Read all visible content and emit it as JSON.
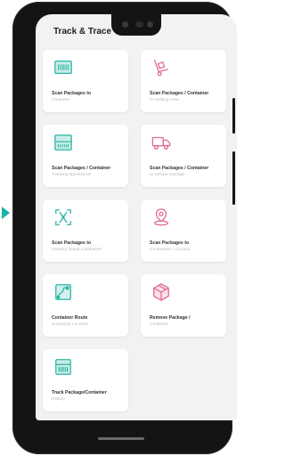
{
  "app": {
    "title": "Track & Trace"
  },
  "tiles": [
    {
      "label": "Scan Packages to",
      "sub": "Container",
      "icon": "barcode-scanner-icon",
      "color": "#2bb5a4"
    },
    {
      "label": "Scan Packages / Container",
      "sub": "to Holding Area",
      "icon": "hand-truck-icon",
      "color": "#e06a8a"
    },
    {
      "label": "Scan Packages / Container",
      "sub": "Tracking Manifest ID",
      "icon": "manifest-id-icon",
      "color": "#2bb5a4"
    },
    {
      "label": "Scan Packages / Container",
      "sub": "to Vehicle Storage",
      "icon": "delivery-truck-icon",
      "color": "#e06a8a"
    },
    {
      "label": "Scan Packages to",
      "sub": "Delivery Depot Containers",
      "icon": "scan-package-icon",
      "color": "#2bb5a4"
    },
    {
      "label": "Scan Packages to",
      "sub": "Containers / Location",
      "icon": "location-pin-icon",
      "color": "#e06a8a"
    },
    {
      "label": "Container Route",
      "sub": "Sorting by Location",
      "icon": "route-map-icon",
      "color": "#2bb5a4"
    },
    {
      "label": "Remove Package /",
      "sub": "Container",
      "icon": "remove-box-icon",
      "color": "#e06a8a"
    },
    {
      "label": "Track Package/Container",
      "sub": "History",
      "icon": "history-barcode-icon",
      "color": "#2bb5a4"
    }
  ],
  "colors": {
    "accent_teal": "#2bb5a4",
    "accent_pink": "#e06a8a",
    "pointer": "#17b3a6"
  }
}
